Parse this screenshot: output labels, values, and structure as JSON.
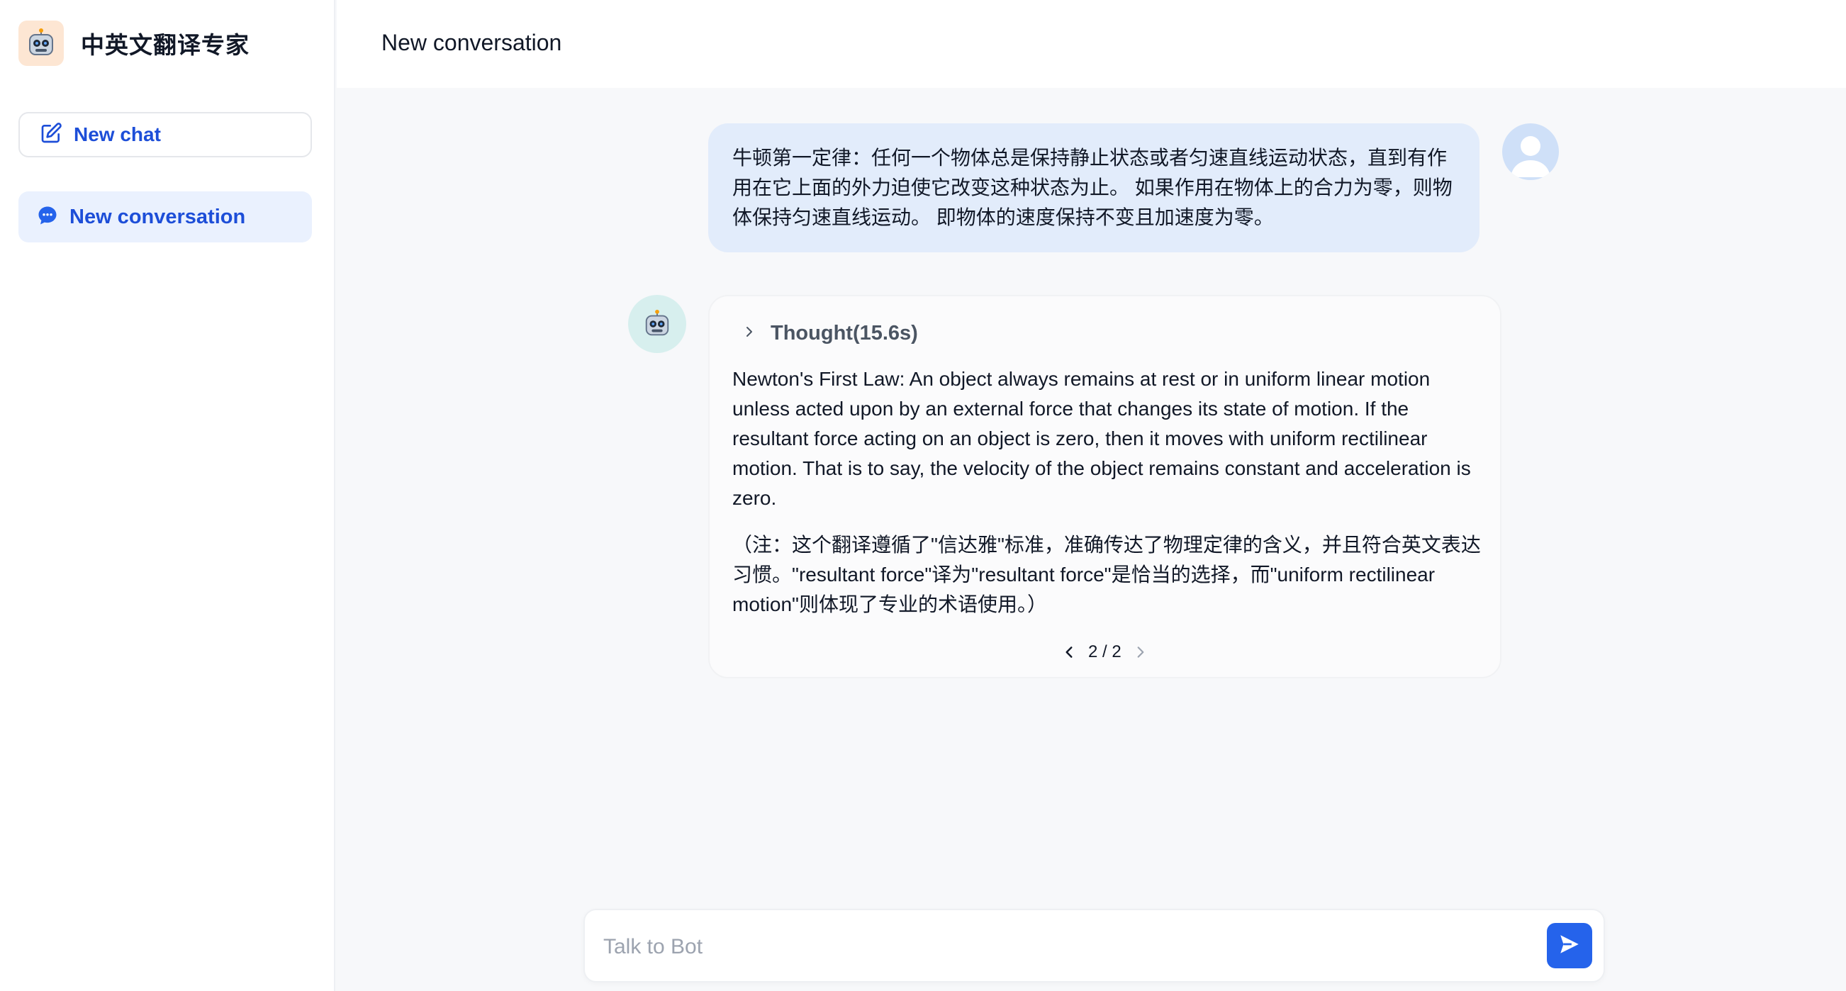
{
  "app": {
    "title": "中英文翻译专家",
    "logo_icon": "robot-icon"
  },
  "sidebar": {
    "new_chat_label": "New chat",
    "conversations": [
      {
        "label": "New conversation",
        "active": true
      }
    ]
  },
  "header": {
    "title": "New conversation"
  },
  "messages": {
    "user": {
      "text": "牛顿第一定律：任何一个物体总是保持静止状态或者匀速直线运动状态，直到有作用在它上面的外力迫使它改变这种状态为止。 如果作用在物体上的合力为零，则物体保持匀速直线运动。 即物体的速度保持不变且加速度为零。"
    },
    "bot": {
      "thought_label": "Thought(15.6s)",
      "answer": "Newton's First Law: An object always remains at rest or in uniform linear motion unless acted upon by an external force that changes its state of motion. If the resultant force acting on an object is zero, then it moves with uniform rectilinear motion. That is to say, the velocity of the object remains constant and acceleration is zero.",
      "note": "（注：这个翻译遵循了\"信达雅\"标准，准确传达了物理定律的含义，并且符合英文表达习惯。\"resultant force\"译为\"resultant force\"是恰当的选择，而\"uniform rectilinear motion\"则体现了专业的术语使用。）",
      "pager": "2 / 2"
    }
  },
  "composer": {
    "placeholder": "Talk to Bot",
    "value": ""
  },
  "colors": {
    "accent": "#2563eb",
    "user_bubble": "#e2ecfb",
    "active_item": "#eaf1fe"
  }
}
